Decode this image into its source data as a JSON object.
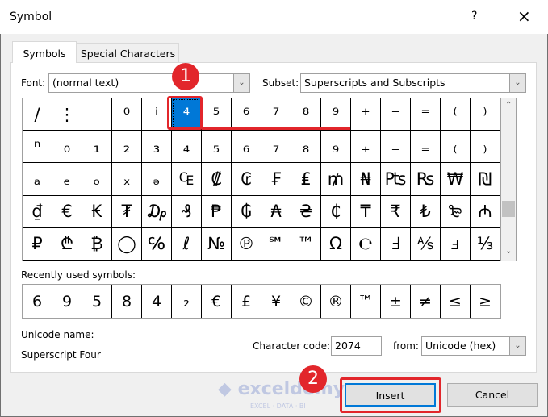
{
  "window": {
    "title": "Symbol",
    "help": "?",
    "close": "×"
  },
  "tabs": [
    {
      "label": "Symbols",
      "active": true
    },
    {
      "label": "Special Characters",
      "active": false
    }
  ],
  "font": {
    "label": "Font:",
    "value": "(normal text)"
  },
  "subset": {
    "label": "Subset:",
    "value": "Superscripts and Subscripts"
  },
  "grid": [
    [
      "/",
      "⋮",
      "",
      "⁰",
      "ⁱ",
      "⁴",
      "⁵",
      "⁶",
      "⁷",
      "⁸",
      "⁹",
      "⁺",
      "⁻",
      "⁼",
      "⁽",
      "⁾"
    ],
    [
      "ⁿ",
      "₀",
      "₁",
      "₂",
      "₃",
      "₄",
      "₅",
      "₆",
      "₇",
      "₈",
      "₉",
      "₊",
      "₋",
      "₌",
      "₍",
      "₎"
    ],
    [
      "ₐ",
      "ₑ",
      "ₒ",
      "ₓ",
      "ₔ",
      "₠",
      "₡",
      "₢",
      "₣",
      "₤",
      "₥",
      "₦",
      "₧",
      "₨",
      "₩",
      "₪"
    ],
    [
      "₫",
      "€",
      "₭",
      "₮",
      "₯",
      "₰",
      "₱",
      "₲",
      "₳",
      "₴",
      "₵",
      "₸",
      "₹",
      "₺",
      "₻",
      "₼"
    ],
    [
      "₽",
      "₾",
      "₿",
      "◯",
      "℅",
      "ℓ",
      "№",
      "℗",
      "℠",
      "™",
      "Ω",
      "℮",
      "Ⅎ",
      "⅍",
      "ⅎ",
      "⅓"
    ]
  ],
  "selected_symbol": "⁴",
  "recent": {
    "label": "Recently used symbols:",
    "items": [
      "6",
      "9",
      "5",
      "8",
      "4",
      "₂",
      "€",
      "£",
      "¥",
      "©",
      "®",
      "™",
      "±",
      "≠",
      "≤",
      "≥"
    ]
  },
  "unicode_name": {
    "label": "Unicode name:",
    "value": "Superscript Four"
  },
  "char_code": {
    "label": "Character code:",
    "value": "2074"
  },
  "from": {
    "label": "from:",
    "value": "Unicode (hex)"
  },
  "buttons": {
    "insert": "Insert",
    "cancel": "Cancel"
  },
  "annotations": {
    "step1": "1",
    "step2": "2",
    "color": "#e2262b"
  },
  "watermark": {
    "name": "exceldemy",
    "tagline": "EXCEL · DATA · BI"
  }
}
